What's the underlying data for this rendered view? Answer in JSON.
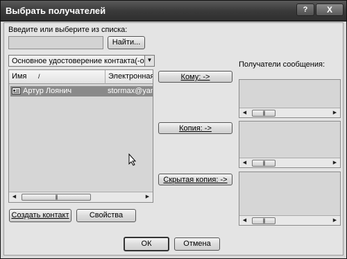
{
  "window": {
    "title": "Выбрать получателей",
    "help": "?",
    "close": "X"
  },
  "search": {
    "label": "Введите или выберите из списка:",
    "value": "",
    "find_button": "Найти..."
  },
  "address_book": {
    "selected": "Основное удостоверение контакта(-ов)"
  },
  "contacts": {
    "columns": [
      "Имя",
      "Электронная"
    ],
    "sort_indicator": "/",
    "rows": [
      {
        "name": "Артур Лоянич",
        "email": "stormax@yand"
      }
    ]
  },
  "recipient_buttons": {
    "to": "Кому: ->",
    "cc": "Копия: ->",
    "bcc": "Скрытая копия: ->"
  },
  "recipients": {
    "label": "Получатели сообщения:"
  },
  "actions": {
    "create_contact": "Создать контакт",
    "properties": "Свойства"
  },
  "footer": {
    "ok": "ОК",
    "cancel": "Отмена"
  },
  "icons": {
    "contact": "contact-card-icon",
    "cursor": "mouse-cursor-icon"
  },
  "colors": {
    "titlebar": "#3a3a3a",
    "selection": "#8a8a8a",
    "background": "#e4e4e4"
  }
}
